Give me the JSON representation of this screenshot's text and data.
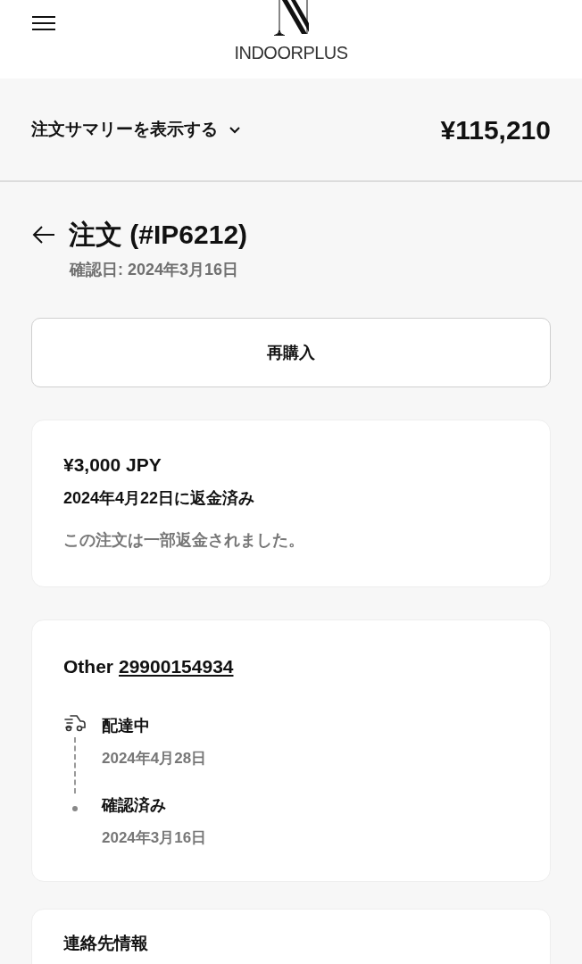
{
  "header": {
    "brand": "INDOORPLUS"
  },
  "summary": {
    "label": "注文サマリーを表示する",
    "expanded": false,
    "total": "¥115,210"
  },
  "order": {
    "title": "注文 (#IP6212)",
    "confirmed": "確認日: 2024年3月16日"
  },
  "reorder_button": "再購入",
  "refund": {
    "amount": "¥3,000 JPY",
    "date": "2024年4月22日に返金済み",
    "note": "この注文は一部返金されました。"
  },
  "shipment": {
    "carrier": "Other",
    "tracking": "29900154934",
    "events": [
      {
        "kind": "current",
        "label": "配達中",
        "date": "2024年4月28日"
      },
      {
        "kind": "done",
        "label": "確認済み",
        "date": "2024年3月16日"
      }
    ]
  },
  "contact": {
    "title": "連絡先情報"
  }
}
